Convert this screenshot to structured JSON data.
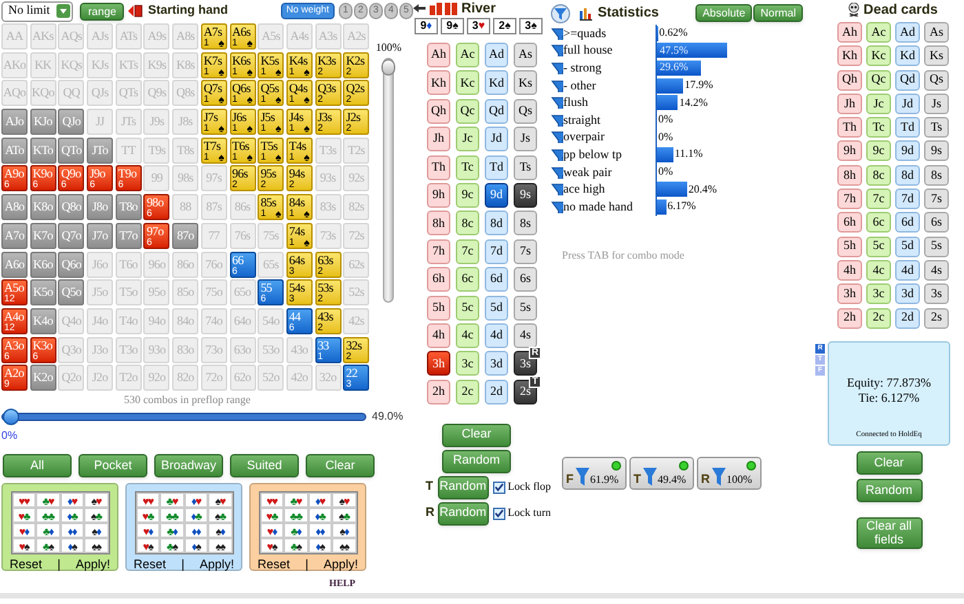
{
  "limit_select": {
    "value": "No limit"
  },
  "range_button": "range",
  "starting_hand": {
    "title": "Starting hand"
  },
  "weights": [
    {
      "label": "No weight",
      "selected": true
    },
    {
      "label": "1",
      "selected": false
    },
    {
      "label": "2",
      "selected": false
    },
    {
      "label": "3",
      "selected": false
    },
    {
      "label": "4",
      "selected": false
    },
    {
      "label": "5",
      "selected": false
    }
  ],
  "hand_grid": [
    [
      {
        "label": "AA",
        "kind": "none"
      },
      {
        "label": "AKs",
        "kind": "none"
      },
      {
        "label": "AQs",
        "kind": "none"
      },
      {
        "label": "AJs",
        "kind": "none"
      },
      {
        "label": "ATs",
        "kind": "none"
      },
      {
        "label": "A9s",
        "kind": "none"
      },
      {
        "label": "A8s",
        "kind": "none"
      },
      {
        "label": "A7s",
        "kind": "suited",
        "count": "1",
        "suit": "♠"
      },
      {
        "label": "A6s",
        "kind": "suited",
        "count": "1",
        "suit": "♠"
      },
      {
        "label": "A5s",
        "kind": "none"
      },
      {
        "label": "A4s",
        "kind": "none"
      },
      {
        "label": "A3s",
        "kind": "none"
      },
      {
        "label": "A2s",
        "kind": "none"
      }
    ],
    [
      {
        "label": "AKo",
        "kind": "none"
      },
      {
        "label": "KK",
        "kind": "none"
      },
      {
        "label": "KQs",
        "kind": "none"
      },
      {
        "label": "KJs",
        "kind": "none"
      },
      {
        "label": "KTs",
        "kind": "none"
      },
      {
        "label": "K9s",
        "kind": "none"
      },
      {
        "label": "K8s",
        "kind": "none"
      },
      {
        "label": "K7s",
        "kind": "suited",
        "count": "1",
        "suit": "♠"
      },
      {
        "label": "K6s",
        "kind": "suited",
        "count": "1",
        "suit": "♠"
      },
      {
        "label": "K5s",
        "kind": "suited",
        "count": "1",
        "suit": "♠"
      },
      {
        "label": "K4s",
        "kind": "suited",
        "count": "1",
        "suit": "♠"
      },
      {
        "label": "K3s",
        "kind": "suited",
        "count": "2"
      },
      {
        "label": "K2s",
        "kind": "suited",
        "count": "2"
      }
    ],
    [
      {
        "label": "AQo",
        "kind": "none"
      },
      {
        "label": "KQo",
        "kind": "none"
      },
      {
        "label": "QQ",
        "kind": "none"
      },
      {
        "label": "QJs",
        "kind": "none"
      },
      {
        "label": "QTs",
        "kind": "none"
      },
      {
        "label": "Q9s",
        "kind": "none"
      },
      {
        "label": "Q8s",
        "kind": "none"
      },
      {
        "label": "Q7s",
        "kind": "suited",
        "count": "1",
        "suit": "♠"
      },
      {
        "label": "Q6s",
        "kind": "suited",
        "count": "1",
        "suit": "♠"
      },
      {
        "label": "Q5s",
        "kind": "suited",
        "count": "1",
        "suit": "♠"
      },
      {
        "label": "Q4s",
        "kind": "suited",
        "count": "1",
        "suit": "♠"
      },
      {
        "label": "Q3s",
        "kind": "suited",
        "count": "2"
      },
      {
        "label": "Q2s",
        "kind": "suited",
        "count": "2"
      }
    ],
    [
      {
        "label": "AJo",
        "kind": "dimmed"
      },
      {
        "label": "KJo",
        "kind": "dimmed"
      },
      {
        "label": "QJo",
        "kind": "dimmed"
      },
      {
        "label": "JJ",
        "kind": "none"
      },
      {
        "label": "JTs",
        "kind": "none"
      },
      {
        "label": "J9s",
        "kind": "none"
      },
      {
        "label": "J8s",
        "kind": "none"
      },
      {
        "label": "J7s",
        "kind": "suited",
        "count": "1",
        "suit": "♠"
      },
      {
        "label": "J6s",
        "kind": "suited",
        "count": "1",
        "suit": "♠"
      },
      {
        "label": "J5s",
        "kind": "suited",
        "count": "1",
        "suit": "♠"
      },
      {
        "label": "J4s",
        "kind": "suited",
        "count": "1",
        "suit": "♠"
      },
      {
        "label": "J3s",
        "kind": "suited",
        "count": "2"
      },
      {
        "label": "J2s",
        "kind": "suited",
        "count": "2"
      }
    ],
    [
      {
        "label": "ATo",
        "kind": "dimmed"
      },
      {
        "label": "KTo",
        "kind": "dimmed"
      },
      {
        "label": "QTo",
        "kind": "dimmed"
      },
      {
        "label": "JTo",
        "kind": "dimmed"
      },
      {
        "label": "TT",
        "kind": "none"
      },
      {
        "label": "T9s",
        "kind": "none"
      },
      {
        "label": "T8s",
        "kind": "none"
      },
      {
        "label": "T7s",
        "kind": "suited",
        "count": "1",
        "suit": "♠"
      },
      {
        "label": "T6s",
        "kind": "suited",
        "count": "1",
        "suit": "♠"
      },
      {
        "label": "T5s",
        "kind": "suited",
        "count": "1",
        "suit": "♠"
      },
      {
        "label": "T4s",
        "kind": "suited",
        "count": "1",
        "suit": "♠"
      },
      {
        "label": "T3s",
        "kind": "none"
      },
      {
        "label": "T2s",
        "kind": "none"
      }
    ],
    [
      {
        "label": "A9o",
        "kind": "offsuit",
        "count": "6"
      },
      {
        "label": "K9o",
        "kind": "offsuit",
        "count": "6"
      },
      {
        "label": "Q9o",
        "kind": "offsuit",
        "count": "6"
      },
      {
        "label": "J9o",
        "kind": "offsuit",
        "count": "6"
      },
      {
        "label": "T9o",
        "kind": "offsuit",
        "count": "6"
      },
      {
        "label": "99",
        "kind": "none"
      },
      {
        "label": "98s",
        "kind": "none"
      },
      {
        "label": "97s",
        "kind": "none"
      },
      {
        "label": "96s",
        "kind": "suited",
        "count": "2"
      },
      {
        "label": "95s",
        "kind": "suited",
        "count": "2"
      },
      {
        "label": "94s",
        "kind": "suited",
        "count": "2"
      },
      {
        "label": "93s",
        "kind": "none"
      },
      {
        "label": "92s",
        "kind": "none"
      }
    ],
    [
      {
        "label": "A8o",
        "kind": "dimmed"
      },
      {
        "label": "K8o",
        "kind": "dimmed"
      },
      {
        "label": "Q8o",
        "kind": "dimmed"
      },
      {
        "label": "J8o",
        "kind": "dimmed"
      },
      {
        "label": "T8o",
        "kind": "dimmed"
      },
      {
        "label": "98o",
        "kind": "offsuit",
        "count": "6"
      },
      {
        "label": "88",
        "kind": "none"
      },
      {
        "label": "87s",
        "kind": "none"
      },
      {
        "label": "86s",
        "kind": "none"
      },
      {
        "label": "85s",
        "kind": "suited",
        "count": "1",
        "suit": "♠"
      },
      {
        "label": "84s",
        "kind": "suited",
        "count": "1",
        "suit": "♠"
      },
      {
        "label": "83s",
        "kind": "none"
      },
      {
        "label": "82s",
        "kind": "none"
      }
    ],
    [
      {
        "label": "A7o",
        "kind": "dimmed"
      },
      {
        "label": "K7o",
        "kind": "dimmed"
      },
      {
        "label": "Q7o",
        "kind": "dimmed"
      },
      {
        "label": "J7o",
        "kind": "dimmed"
      },
      {
        "label": "T7o",
        "kind": "dimmed"
      },
      {
        "label": "97o",
        "kind": "offsuit",
        "count": "6"
      },
      {
        "label": "87o",
        "kind": "dimmed"
      },
      {
        "label": "77",
        "kind": "none"
      },
      {
        "label": "76s",
        "kind": "none"
      },
      {
        "label": "75s",
        "kind": "none"
      },
      {
        "label": "74s",
        "kind": "suited",
        "count": "1",
        "suit": "♠"
      },
      {
        "label": "73s",
        "kind": "none"
      },
      {
        "label": "72s",
        "kind": "none"
      }
    ],
    [
      {
        "label": "A6o",
        "kind": "dimmed"
      },
      {
        "label": "K6o",
        "kind": "dimmed"
      },
      {
        "label": "Q6o",
        "kind": "dimmed"
      },
      {
        "label": "J6o",
        "kind": "none"
      },
      {
        "label": "T6o",
        "kind": "none"
      },
      {
        "label": "96o",
        "kind": "none"
      },
      {
        "label": "86o",
        "kind": "none"
      },
      {
        "label": "76o",
        "kind": "none"
      },
      {
        "label": "66",
        "kind": "pair",
        "count": "6"
      },
      {
        "label": "65s",
        "kind": "none"
      },
      {
        "label": "64s",
        "kind": "suited",
        "count": "3"
      },
      {
        "label": "63s",
        "kind": "suited",
        "count": "2"
      },
      {
        "label": "62s",
        "kind": "none"
      }
    ],
    [
      {
        "label": "A5o",
        "kind": "offsuit",
        "count": "12"
      },
      {
        "label": "K5o",
        "kind": "dimmed"
      },
      {
        "label": "Q5o",
        "kind": "dimmed"
      },
      {
        "label": "J5o",
        "kind": "none"
      },
      {
        "label": "T5o",
        "kind": "none"
      },
      {
        "label": "95o",
        "kind": "none"
      },
      {
        "label": "85o",
        "kind": "none"
      },
      {
        "label": "75o",
        "kind": "none"
      },
      {
        "label": "65o",
        "kind": "none"
      },
      {
        "label": "55",
        "kind": "pair",
        "count": "6"
      },
      {
        "label": "54s",
        "kind": "suited",
        "count": "3"
      },
      {
        "label": "53s",
        "kind": "suited",
        "count": "2"
      },
      {
        "label": "52s",
        "kind": "none"
      }
    ],
    [
      {
        "label": "A4o",
        "kind": "offsuit",
        "count": "12"
      },
      {
        "label": "K4o",
        "kind": "dimmed"
      },
      {
        "label": "Q4o",
        "kind": "none"
      },
      {
        "label": "J4o",
        "kind": "none"
      },
      {
        "label": "T4o",
        "kind": "none"
      },
      {
        "label": "94o",
        "kind": "none"
      },
      {
        "label": "84o",
        "kind": "none"
      },
      {
        "label": "74o",
        "kind": "none"
      },
      {
        "label": "64o",
        "kind": "none"
      },
      {
        "label": "54o",
        "kind": "none"
      },
      {
        "label": "44",
        "kind": "pair",
        "count": "6"
      },
      {
        "label": "43s",
        "kind": "suited",
        "count": "2"
      },
      {
        "label": "42s",
        "kind": "none"
      }
    ],
    [
      {
        "label": "A3o",
        "kind": "offsuit",
        "count": "6"
      },
      {
        "label": "K3o",
        "kind": "offsuit",
        "count": "6"
      },
      {
        "label": "Q3o",
        "kind": "none"
      },
      {
        "label": "J3o",
        "kind": "none"
      },
      {
        "label": "T3o",
        "kind": "none"
      },
      {
        "label": "93o",
        "kind": "none"
      },
      {
        "label": "83o",
        "kind": "none"
      },
      {
        "label": "73o",
        "kind": "none"
      },
      {
        "label": "63o",
        "kind": "none"
      },
      {
        "label": "53o",
        "kind": "none"
      },
      {
        "label": "43o",
        "kind": "none"
      },
      {
        "label": "33",
        "kind": "pair",
        "count": "1"
      },
      {
        "label": "32s",
        "kind": "suited",
        "count": "2"
      }
    ],
    [
      {
        "label": "A2o",
        "kind": "offsuit",
        "count": "9"
      },
      {
        "label": "K2o",
        "kind": "dimmed"
      },
      {
        "label": "Q2o",
        "kind": "none"
      },
      {
        "label": "J2o",
        "kind": "none"
      },
      {
        "label": "T2o",
        "kind": "none"
      },
      {
        "label": "92o",
        "kind": "none"
      },
      {
        "label": "82o",
        "kind": "none"
      },
      {
        "label": "72o",
        "kind": "none"
      },
      {
        "label": "62o",
        "kind": "none"
      },
      {
        "label": "52o",
        "kind": "none"
      },
      {
        "label": "42o",
        "kind": "none"
      },
      {
        "label": "32o",
        "kind": "none"
      },
      {
        "label": "22",
        "kind": "pair",
        "count": "3"
      }
    ]
  ],
  "vertical_slider": {
    "label": "100%",
    "level": 1
  },
  "combos_text": "530 combos in preflop range",
  "range_slider": {
    "level": 0,
    "reading": "49.0%",
    "min_label": "0%"
  },
  "range_buttons": [
    "All",
    "Pocket",
    "Broadway",
    "Suited",
    "Clear"
  ],
  "suit_panels": [
    {
      "color": "#bfe88f",
      "cells": [
        "♥♥",
        "♣♥",
        "♦♥",
        "♠♥",
        "♥♣",
        "♣♣",
        "♦♣",
        "♠♣",
        "♥♦",
        "♣♦",
        "♦♦",
        "♠♦",
        "♥♠",
        "♣♠",
        "♦♠",
        "♠♠"
      ],
      "reset": "Reset",
      "separator": "|",
      "apply": "Apply!"
    },
    {
      "color": "#bfe0fa",
      "cells": [
        "♥♥",
        "♣♥",
        "♦♥",
        "♠♥",
        "♥♣",
        "♣♣",
        "♦♣",
        "♠♣",
        "♥♦",
        "♣♦",
        "♦♦",
        "♠♦",
        "♥♠",
        "♣♠",
        "♦♠",
        "♠♠"
      ],
      "reset": "Reset",
      "separator": "|",
      "apply": "Apply!"
    },
    {
      "color": "#fbcf9f",
      "cells": [
        "♥♥",
        "♣♥",
        "♦♥",
        "♠♥",
        "♥♣",
        "♣♣",
        "♦♣",
        "♠♣",
        "♥♦",
        "♣♦",
        "♦♦",
        "♠♦",
        "♥♠",
        "♣♠",
        "♦♠",
        "♠♠"
      ],
      "reset": "Reset",
      "separator": "|",
      "apply": "Apply!"
    }
  ],
  "help": "HELP",
  "board": {
    "title": "River",
    "cards": [
      {
        "rank": "9",
        "suit": "♦",
        "color": "#1050d0"
      },
      {
        "rank": "9",
        "suit": "♠",
        "color": "#111111"
      },
      {
        "rank": "3",
        "suit": "♥",
        "color": "#d01010"
      },
      {
        "rank": "2",
        "suit": "♠",
        "color": "#111111"
      },
      {
        "rank": "3",
        "suit": "♠",
        "color": "#111111"
      }
    ],
    "deck": [
      [
        {
          "label": "Ah",
          "selected": false
        },
        {
          "label": "Ac",
          "selected": false
        },
        {
          "label": "Ad",
          "selected": false
        },
        {
          "label": "As",
          "selected": false
        }
      ],
      [
        {
          "label": "Kh",
          "selected": false
        },
        {
          "label": "Kc",
          "selected": false
        },
        {
          "label": "Kd",
          "selected": false
        },
        {
          "label": "Ks",
          "selected": false
        }
      ],
      [
        {
          "label": "Qh",
          "selected": false
        },
        {
          "label": "Qc",
          "selected": false
        },
        {
          "label": "Qd",
          "selected": false
        },
        {
          "label": "Qs",
          "selected": false
        }
      ],
      [
        {
          "label": "Jh",
          "selected": false
        },
        {
          "label": "Jc",
          "selected": false
        },
        {
          "label": "Jd",
          "selected": false
        },
        {
          "label": "Js",
          "selected": false
        }
      ],
      [
        {
          "label": "Th",
          "selected": false
        },
        {
          "label": "Tc",
          "selected": false
        },
        {
          "label": "Td",
          "selected": false
        },
        {
          "label": "Ts",
          "selected": false
        }
      ],
      [
        {
          "label": "9h",
          "selected": false
        },
        {
          "label": "9c",
          "selected": false
        },
        {
          "label": "9d",
          "selected": true
        },
        {
          "label": "9s",
          "selected": true
        }
      ],
      [
        {
          "label": "8h",
          "selected": false
        },
        {
          "label": "8c",
          "selected": false
        },
        {
          "label": "8d",
          "selected": false
        },
        {
          "label": "8s",
          "selected": false
        }
      ],
      [
        {
          "label": "7h",
          "selected": false
        },
        {
          "label": "7c",
          "selected": false
        },
        {
          "label": "7d",
          "selected": false
        },
        {
          "label": "7s",
          "selected": false
        }
      ],
      [
        {
          "label": "6h",
          "selected": false
        },
        {
          "label": "6c",
          "selected": false
        },
        {
          "label": "6d",
          "selected": false
        },
        {
          "label": "6s",
          "selected": false
        }
      ],
      [
        {
          "label": "5h",
          "selected": false
        },
        {
          "label": "5c",
          "selected": false
        },
        {
          "label": "5d",
          "selected": false
        },
        {
          "label": "5s",
          "selected": false
        }
      ],
      [
        {
          "label": "4h",
          "selected": false
        },
        {
          "label": "4c",
          "selected": false
        },
        {
          "label": "4d",
          "selected": false
        },
        {
          "label": "4s",
          "selected": false
        }
      ],
      [
        {
          "label": "3h",
          "selected": true
        },
        {
          "label": "3c",
          "selected": false
        },
        {
          "label": "3d",
          "selected": false
        },
        {
          "label": "3s",
          "selected": true,
          "badge": "R"
        }
      ],
      [
        {
          "label": "2h",
          "selected": false
        },
        {
          "label": "2c",
          "selected": false
        },
        {
          "label": "2d",
          "selected": false
        },
        {
          "label": "2s",
          "selected": true,
          "badge": "T"
        }
      ]
    ],
    "clear": "Clear",
    "random": "Random",
    "street_randoms": [
      {
        "letter": "T",
        "button": "Random",
        "lock_label": "Lock flop",
        "checked": true
      },
      {
        "letter": "R",
        "button": "Random",
        "lock_label": "Lock turn",
        "checked": true
      }
    ]
  },
  "statistics": {
    "title": "Statistics",
    "modes": [
      {
        "label": "Absolute"
      },
      {
        "label": "Normal"
      }
    ],
    "rows": [
      {
        "label": ">=quads",
        "level": 0.0062,
        "value": "0.62%"
      },
      {
        "label": "full house",
        "level": 0.475,
        "value": "47.5%"
      },
      {
        "label": "- strong",
        "level": 0.296,
        "value": "29.6%"
      },
      {
        "label": "- other",
        "level": 0.179,
        "value": "17.9%"
      },
      {
        "label": "flush",
        "level": 0.142,
        "value": "14.2%"
      },
      {
        "label": "straight",
        "level": 0,
        "value": "0%"
      },
      {
        "label": "overpair",
        "level": 0,
        "value": "0%"
      },
      {
        "label": "pp below tp",
        "level": 0.111,
        "value": "11.1%"
      },
      {
        "label": "weak pair",
        "level": 0,
        "value": "0%"
      },
      {
        "label": "ace high",
        "level": 0.204,
        "value": "20.4%"
      },
      {
        "label": "no made hand",
        "level": 0.0617,
        "value": "6.17%"
      }
    ],
    "hint": "Press TAB for combo mode",
    "filters": [
      {
        "letter": "F",
        "value": "61.9%",
        "on": true
      },
      {
        "letter": "T",
        "value": "49.4%",
        "on": true
      },
      {
        "letter": "R",
        "value": "100%",
        "on": true
      }
    ]
  },
  "dead_cards": {
    "title": "Dead cards",
    "deck": [
      [
        {
          "label": "Ah",
          "selected": false
        },
        {
          "label": "Ac",
          "selected": false
        },
        {
          "label": "Ad",
          "selected": false
        },
        {
          "label": "As",
          "selected": false
        }
      ],
      [
        {
          "label": "Kh",
          "selected": false
        },
        {
          "label": "Kc",
          "selected": false
        },
        {
          "label": "Kd",
          "selected": false
        },
        {
          "label": "Ks",
          "selected": false
        }
      ],
      [
        {
          "label": "Qh",
          "selected": false
        },
        {
          "label": "Qc",
          "selected": false
        },
        {
          "label": "Qd",
          "selected": false
        },
        {
          "label": "Qs",
          "selected": false
        }
      ],
      [
        {
          "label": "Jh",
          "selected": false
        },
        {
          "label": "Jc",
          "selected": false
        },
        {
          "label": "Jd",
          "selected": false
        },
        {
          "label": "Js",
          "selected": false
        }
      ],
      [
        {
          "label": "Th",
          "selected": false
        },
        {
          "label": "Tc",
          "selected": false
        },
        {
          "label": "Td",
          "selected": false
        },
        {
          "label": "Ts",
          "selected": false
        }
      ],
      [
        {
          "label": "9h",
          "selected": false
        },
        {
          "label": "9c",
          "selected": false
        },
        {
          "label": "9d",
          "selected": false
        },
        {
          "label": "9s",
          "selected": false
        }
      ],
      [
        {
          "label": "8h",
          "selected": false
        },
        {
          "label": "8c",
          "selected": false
        },
        {
          "label": "8d",
          "selected": false
        },
        {
          "label": "8s",
          "selected": false
        }
      ],
      [
        {
          "label": "7h",
          "selected": false
        },
        {
          "label": "7c",
          "selected": false
        },
        {
          "label": "7d",
          "selected": false
        },
        {
          "label": "7s",
          "selected": false
        }
      ],
      [
        {
          "label": "6h",
          "selected": false
        },
        {
          "label": "6c",
          "selected": false
        },
        {
          "label": "6d",
          "selected": false
        },
        {
          "label": "6s",
          "selected": false
        }
      ],
      [
        {
          "label": "5h",
          "selected": false
        },
        {
          "label": "5c",
          "selected": false
        },
        {
          "label": "5d",
          "selected": false
        },
        {
          "label": "5s",
          "selected": false
        }
      ],
      [
        {
          "label": "4h",
          "selected": false
        },
        {
          "label": "4c",
          "selected": false
        },
        {
          "label": "4d",
          "selected": false
        },
        {
          "label": "4s",
          "selected": false
        }
      ],
      [
        {
          "label": "3h",
          "selected": false
        },
        {
          "label": "3c",
          "selected": false
        },
        {
          "label": "3d",
          "selected": false
        },
        {
          "label": "3s",
          "selected": false
        }
      ],
      [
        {
          "label": "2h",
          "selected": false
        },
        {
          "label": "2c",
          "selected": false
        },
        {
          "label": "2d",
          "selected": false
        },
        {
          "label": "2s",
          "selected": false
        }
      ]
    ]
  },
  "equity": {
    "tabs": [
      {
        "label": "R",
        "selected": true
      },
      {
        "label": "T",
        "selected": false
      },
      {
        "label": "F",
        "selected": false
      }
    ],
    "equity": "Equity: 77.873%",
    "tie": "Tie: 6.127%",
    "connection": "Connected to HoldEq"
  },
  "equity_buttons": [
    {
      "label": "Clear"
    },
    {
      "label": "Random"
    },
    {
      "label": "Clear all fields"
    }
  ]
}
